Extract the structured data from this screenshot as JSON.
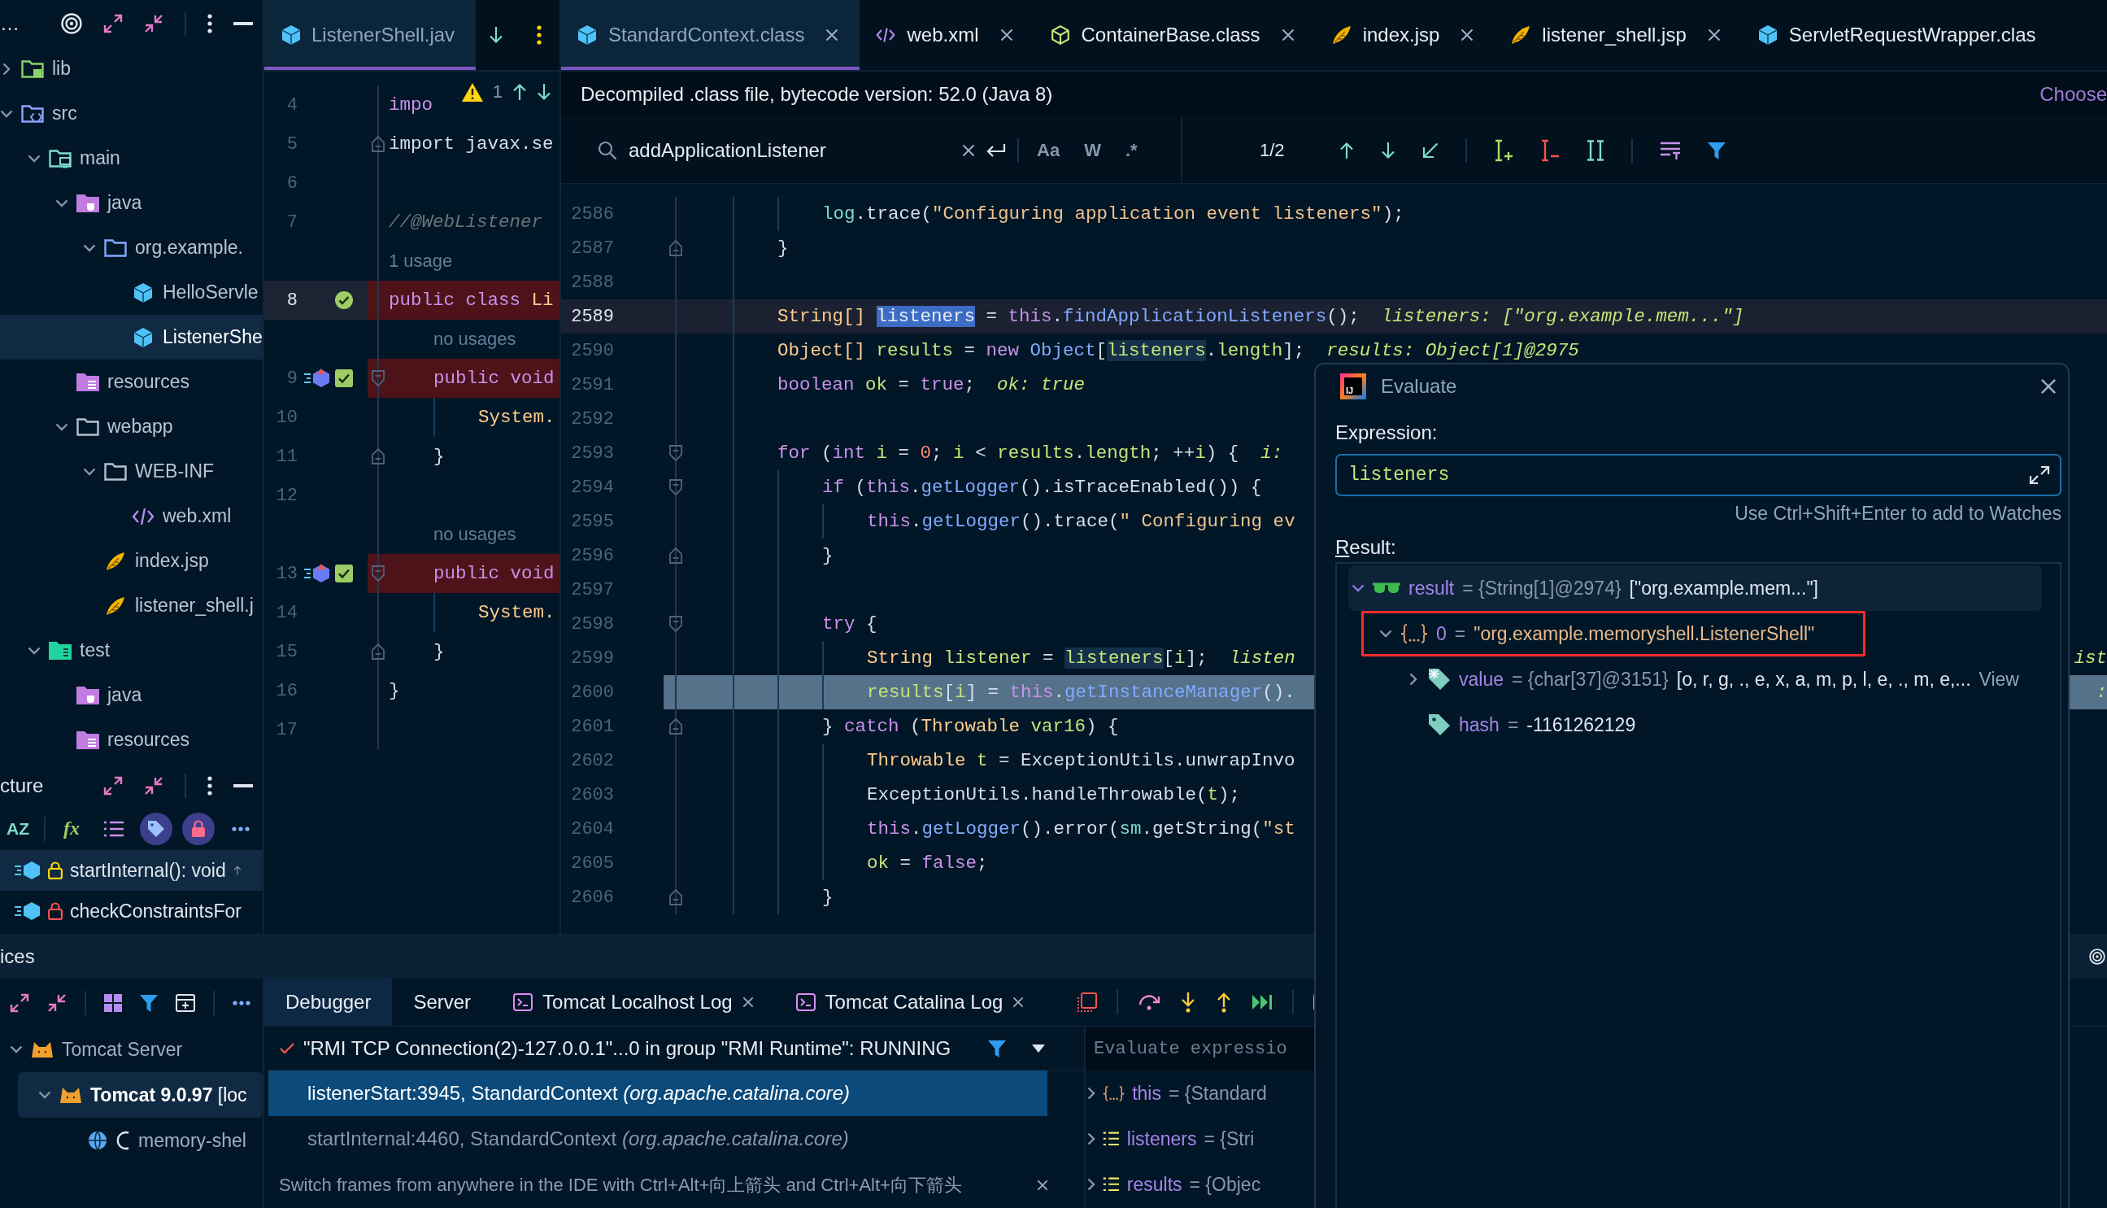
{
  "project_panel": {
    "title": "…",
    "tree": [
      {
        "label": "lib",
        "kind": "library",
        "expandable": true,
        "expanded": false,
        "selected": false
      },
      {
        "label": "src",
        "kind": "source_folder",
        "expandable": true,
        "expanded": true,
        "selected": false,
        "children": [
          {
            "label": "main",
            "kind": "module_folder",
            "expandable": true,
            "expanded": true,
            "selected": false,
            "children": [
              {
                "label": "java",
                "kind": "java_root",
                "expandable": true,
                "expanded": true,
                "selected": false,
                "children": [
                  {
                    "label": "org.example.",
                    "kind": "package",
                    "expandable": true,
                    "expanded": true,
                    "selected": false,
                    "children": [
                      {
                        "label": "HelloServle",
                        "kind": "class",
                        "expandable": false,
                        "selected": false
                      },
                      {
                        "label": "ListenerShe",
                        "kind": "class",
                        "expandable": false,
                        "selected": true
                      }
                    ]
                  }
                ]
              },
              {
                "label": "resources",
                "kind": "resources_root",
                "expandable": false,
                "selected": false
              },
              {
                "label": "webapp",
                "kind": "folder",
                "expandable": true,
                "expanded": true,
                "selected": false,
                "children": [
                  {
                    "label": "WEB-INF",
                    "kind": "folder",
                    "expandable": true,
                    "expanded": true,
                    "selected": false,
                    "children": [
                      {
                        "label": "web.xml",
                        "kind": "xml",
                        "expandable": false,
                        "selected": false
                      }
                    ]
                  },
                  {
                    "label": "index.jsp",
                    "kind": "jsp",
                    "expandable": false,
                    "selected": false
                  },
                  {
                    "label": "listener_shell.j",
                    "kind": "jsp",
                    "expandable": false,
                    "selected": false
                  }
                ]
              }
            ]
          },
          {
            "label": "test",
            "kind": "test_root",
            "expandable": true,
            "expanded": true,
            "selected": false,
            "children": [
              {
                "label": "java",
                "kind": "java_root",
                "expandable": false,
                "selected": false
              },
              {
                "label": "resources",
                "kind": "resources_root",
                "expandable": false,
                "selected": false
              }
            ]
          }
        ]
      }
    ]
  },
  "structure_panel": {
    "title": "cture",
    "toolbar": [
      {
        "kind": "sort",
        "text": "AZ",
        "on": false
      },
      {
        "kind": "functions",
        "text": "fx",
        "on": false
      },
      {
        "kind": "list",
        "on": false
      },
      {
        "kind": "tag",
        "on": true
      },
      {
        "kind": "lock",
        "on": true
      },
      {
        "kind": "more",
        "on": false
      }
    ],
    "items": [
      {
        "label": "startInternal(): void",
        "kind": "protected_method",
        "overrides": true,
        "selected": true
      },
      {
        "label": "checkConstraintsFor",
        "kind": "private_method",
        "overrides": false,
        "selected": false
      }
    ]
  },
  "left_editor": {
    "tabs": [
      {
        "label": "ListenerShell.jav",
        "kind": "class",
        "closable": false,
        "selected": true
      }
    ],
    "inspection": {
      "warnings": "1"
    },
    "lines": [
      {
        "number": "4",
        "caret": false,
        "breakpoint": false,
        "tokens": [
          {
            "kind": "kw",
            "text": "impo"
          }
        ]
      },
      {
        "number": "5",
        "caret": false,
        "breakpoint": false,
        "markers": [
          {
            "kind": "fold_end"
          }
        ],
        "tokens": [
          {
            "kind": "plain",
            "text": "import javax.se"
          }
        ]
      },
      {
        "number": "6",
        "caret": false,
        "breakpoint": false
      },
      {
        "number": "7",
        "caret": false,
        "breakpoint": false,
        "tokens": [
          {
            "kind": "comment",
            "text": "//@WebListener"
          }
        ]
      },
      {
        "number": "8",
        "hint": "1 usage",
        "caret": true,
        "breakpoint": true,
        "markers": [
          {
            "kind": "verified_breakpoint"
          }
        ],
        "tokens": [
          {
            "kind": "kw",
            "text": "public class "
          },
          {
            "kind": "type",
            "text": "Li"
          }
        ],
        "children": [
          {
            "number": "9",
            "hint": "no usages",
            "caret": false,
            "breakpoint": true,
            "markers": [
              {
                "kind": "method_breakpoint"
              },
              {
                "kind": "enabled_checkbox"
              },
              {
                "kind": "fold_start"
              }
            ],
            "tokens": [
              {
                "kind": "kw",
                "text": "public void"
              }
            ],
            "children": [
              {
                "number": "10",
                "caret": false,
                "breakpoint": false,
                "tokens": [
                  {
                    "kind": "type",
                    "text": "System."
                  }
                ]
              }
            ]
          },
          {
            "number": "11",
            "caret": false,
            "breakpoint": false,
            "markers": [
              {
                "kind": "fold_end"
              }
            ],
            "tokens": [
              {
                "kind": "plain",
                "text": "}"
              }
            ]
          },
          {
            "number": "12",
            "caret": false,
            "breakpoint": false
          },
          {
            "number": "13",
            "hint": "no usages",
            "caret": false,
            "breakpoint": true,
            "markers": [
              {
                "kind": "method_breakpoint"
              },
              {
                "kind": "enabled_checkbox"
              },
              {
                "kind": "fold_start"
              }
            ],
            "tokens": [
              {
                "kind": "kw",
                "text": "public void"
              }
            ],
            "children": [
              {
                "number": "14",
                "caret": false,
                "breakpoint": false,
                "tokens": [
                  {
                    "kind": "type",
                    "text": "System."
                  }
                ]
              }
            ]
          },
          {
            "number": "15",
            "caret": false,
            "breakpoint": false,
            "markers": [
              {
                "kind": "fold_end"
              }
            ],
            "tokens": [
              {
                "kind": "plain",
                "text": "}"
              }
            ]
          }
        ]
      },
      {
        "number": "16",
        "caret": false,
        "breakpoint": false,
        "tokens": [
          {
            "kind": "plain",
            "text": "}"
          }
        ]
      },
      {
        "number": "17",
        "caret": false,
        "breakpoint": false
      }
    ]
  },
  "main_editor": {
    "tabs": [
      {
        "label": "StandardContext.class",
        "kind": "class",
        "closable": true,
        "selected": true
      },
      {
        "label": "web.xml",
        "kind": "xml",
        "closable": true,
        "selected": false
      },
      {
        "label": "ContainerBase.class",
        "kind": "abstract_class",
        "closable": true,
        "selected": false
      },
      {
        "label": "index.jsp",
        "kind": "jsp",
        "closable": true,
        "selected": false
      },
      {
        "label": "listener_shell.jsp",
        "kind": "jsp",
        "closable": true,
        "selected": false
      },
      {
        "label": "ServletRequestWrapper.clas",
        "kind": "class",
        "closable": false,
        "selected": false
      }
    ],
    "info_bar": {
      "text": "Decompiled .class file, bytecode version: 52.0 (Java 8)",
      "action": "Choose"
    },
    "search": {
      "value": "addApplicationListener",
      "options": [
        {
          "text": "Aa",
          "on": false
        },
        {
          "text": "W",
          "on": false
        },
        {
          "text": ".*",
          "on": false
        }
      ],
      "match_count": "1/2"
    },
    "continued_lines": [
      {
        "number": "2586",
        "caret": false,
        "execution": false,
        "tokens": [
          {
            "kind": "field",
            "text": "log"
          },
          {
            "kind": "plain",
            "text": ".trace("
          },
          {
            "kind": "str",
            "text": "\"Configuring application event listeners\""
          },
          {
            "kind": "plain",
            "text": ");"
          }
        ]
      }
    ],
    "lines": [
      {
        "number": "2587",
        "caret": false,
        "execution": false,
        "markers": [
          {
            "kind": "fold_end"
          }
        ],
        "tokens": [
          {
            "kind": "plain",
            "text": "}"
          }
        ]
      },
      {
        "number": "2588",
        "caret": false,
        "execution": false
      },
      {
        "number": "2589",
        "caret": true,
        "execution": false,
        "tokens": [
          {
            "kind": "type",
            "text": "String[] "
          },
          {
            "kind": "sel",
            "text": "listeners"
          },
          {
            "kind": "plain",
            "text": " = "
          },
          {
            "kind": "kw",
            "text": "this"
          },
          {
            "kind": "plain",
            "text": "."
          },
          {
            "kind": "fn",
            "text": "findApplicationListeners"
          },
          {
            "kind": "plain",
            "text": "();"
          }
        ],
        "inline": "listeners: [\"org.example.mem...\"]"
      },
      {
        "number": "2590",
        "caret": false,
        "execution": false,
        "tokens": [
          {
            "kind": "type",
            "text": "Object[] "
          },
          {
            "kind": "var",
            "text": "results"
          },
          {
            "kind": "plain",
            "text": " = "
          },
          {
            "kind": "kw",
            "text": "new "
          },
          {
            "kind": "cls",
            "text": "Object"
          },
          {
            "kind": "plain",
            "text": "["
          },
          {
            "kind": "usage",
            "text": "listeners"
          },
          {
            "kind": "plain",
            "text": "."
          },
          {
            "kind": "var",
            "text": "length"
          },
          {
            "kind": "plain",
            "text": "];"
          }
        ],
        "inline": "results: Object[1]@2975"
      },
      {
        "number": "2591",
        "caret": false,
        "execution": false,
        "tokens": [
          {
            "kind": "kw",
            "text": "boolean "
          },
          {
            "kind": "var",
            "text": "ok"
          },
          {
            "kind": "plain",
            "text": " = "
          },
          {
            "kind": "kw",
            "text": "true"
          },
          {
            "kind": "plain",
            "text": ";"
          }
        ],
        "inline": "ok: true"
      },
      {
        "number": "2592",
        "caret": false,
        "execution": false
      },
      {
        "number": "2593",
        "caret": false,
        "execution": false,
        "markers": [
          {
            "kind": "fold_start"
          }
        ],
        "tokens": [
          {
            "kind": "kw",
            "text": "for"
          },
          {
            "kind": "plain",
            "text": " ("
          },
          {
            "kind": "kw",
            "text": "int "
          },
          {
            "kind": "var",
            "text": "i"
          },
          {
            "kind": "plain",
            "text": " = "
          },
          {
            "kind": "num",
            "text": "0"
          },
          {
            "kind": "plain",
            "text": "; "
          },
          {
            "kind": "var",
            "text": "i"
          },
          {
            "kind": "plain",
            "text": " < "
          },
          {
            "kind": "var",
            "text": "results"
          },
          {
            "kind": "plain",
            "text": "."
          },
          {
            "kind": "var",
            "text": "length"
          },
          {
            "kind": "plain",
            "text": "; ++"
          },
          {
            "kind": "var",
            "text": "i"
          },
          {
            "kind": "plain",
            "text": ") {"
          }
        ],
        "inline": "i:",
        "children": [
          {
            "number": "2594",
            "caret": false,
            "execution": false,
            "markers": [
              {
                "kind": "fold_start"
              }
            ],
            "tokens": [
              {
                "kind": "kw",
                "text": "if"
              },
              {
                "kind": "plain",
                "text": " ("
              },
              {
                "kind": "kw",
                "text": "this"
              },
              {
                "kind": "plain",
                "text": "."
              },
              {
                "kind": "fn",
                "text": "getLogger"
              },
              {
                "kind": "plain",
                "text": "().isTraceEnabled()) {"
              }
            ],
            "children": [
              {
                "number": "2595",
                "caret": false,
                "execution": false,
                "tokens": [
                  {
                    "kind": "kw",
                    "text": "this"
                  },
                  {
                    "kind": "plain",
                    "text": "."
                  },
                  {
                    "kind": "fn",
                    "text": "getLogger"
                  },
                  {
                    "kind": "plain",
                    "text": "().trace("
                  },
                  {
                    "kind": "str",
                    "text": "\" Configuring ev"
                  }
                ]
              }
            ]
          },
          {
            "number": "2596",
            "caret": false,
            "execution": false,
            "markers": [
              {
                "kind": "fold_end"
              }
            ],
            "tokens": [
              {
                "kind": "plain",
                "text": "}"
              }
            ]
          },
          {
            "number": "2597",
            "caret": false,
            "execution": false
          },
          {
            "number": "2598",
            "caret": false,
            "execution": false,
            "markers": [
              {
                "kind": "fold_start"
              }
            ],
            "tokens": [
              {
                "kind": "kw",
                "text": "try"
              },
              {
                "kind": "plain",
                "text": " {"
              }
            ],
            "children": [
              {
                "number": "2599",
                "caret": false,
                "execution": false,
                "tokens": [
                  {
                    "kind": "type",
                    "text": "String "
                  },
                  {
                    "kind": "var",
                    "text": "listener"
                  },
                  {
                    "kind": "plain",
                    "text": " = "
                  },
                  {
                    "kind": "usage",
                    "text": "listeners"
                  },
                  {
                    "kind": "plain",
                    "text": "["
                  },
                  {
                    "kind": "var",
                    "text": "i"
                  },
                  {
                    "kind": "plain",
                    "text": "];"
                  }
                ],
                "inline": "listen",
                "right": "ist"
              },
              {
                "number": "2600",
                "caret": false,
                "execution": true,
                "tokens": [
                  {
                    "kind": "var",
                    "text": "results"
                  },
                  {
                    "kind": "plain",
                    "text": "["
                  },
                  {
                    "kind": "var",
                    "text": "i"
                  },
                  {
                    "kind": "plain",
                    "text": "] = "
                  },
                  {
                    "kind": "kw",
                    "text": "this"
                  },
                  {
                    "kind": "plain",
                    "text": "."
                  },
                  {
                    "kind": "fn",
                    "text": "getInstanceManager"
                  },
                  {
                    "kind": "plain",
                    "text": "()."
                  }
                ],
                "right": ":"
              }
            ]
          },
          {
            "number": "2601",
            "caret": false,
            "execution": false,
            "markers": [
              {
                "kind": "fold_end"
              }
            ],
            "tokens": [
              {
                "kind": "plain",
                "text": "} "
              },
              {
                "kind": "kw",
                "text": "catch"
              },
              {
                "kind": "plain",
                "text": " ("
              },
              {
                "kind": "type",
                "text": "Throwable "
              },
              {
                "kind": "var",
                "text": "var16"
              },
              {
                "kind": "plain",
                "text": ") {"
              }
            ],
            "children": [
              {
                "number": "2602",
                "caret": false,
                "execution": false,
                "tokens": [
                  {
                    "kind": "type",
                    "text": "Throwable "
                  },
                  {
                    "kind": "var",
                    "text": "t"
                  },
                  {
                    "kind": "plain",
                    "text": " = ExceptionUtils.unwrapInvo"
                  }
                ]
              },
              {
                "number": "2603",
                "caret": false,
                "execution": false,
                "tokens": [
                  {
                    "kind": "plain",
                    "text": "ExceptionUtils.handleThrowable("
                  },
                  {
                    "kind": "var",
                    "text": "t"
                  },
                  {
                    "kind": "plain",
                    "text": ");"
                  }
                ]
              },
              {
                "number": "2604",
                "caret": false,
                "execution": false,
                "tokens": [
                  {
                    "kind": "kw",
                    "text": "this"
                  },
                  {
                    "kind": "plain",
                    "text": "."
                  },
                  {
                    "kind": "fn",
                    "text": "getLogger"
                  },
                  {
                    "kind": "plain",
                    "text": "().error("
                  },
                  {
                    "kind": "field",
                    "text": "sm"
                  },
                  {
                    "kind": "plain",
                    "text": ".getString("
                  },
                  {
                    "kind": "str",
                    "text": "\"st"
                  }
                ]
              },
              {
                "number": "2605",
                "caret": false,
                "execution": false,
                "tokens": [
                  {
                    "kind": "var",
                    "text": "ok"
                  },
                  {
                    "kind": "plain",
                    "text": " = "
                  },
                  {
                    "kind": "kw",
                    "text": "false"
                  },
                  {
                    "kind": "plain",
                    "text": ";"
                  }
                ]
              }
            ]
          },
          {
            "number": "2606",
            "caret": false,
            "execution": false,
            "markers": [
              {
                "kind": "fold_end"
              }
            ],
            "tokens": [
              {
                "kind": "plain",
                "text": "}"
              }
            ]
          }
        ]
      }
    ]
  },
  "services": {
    "title": "ices",
    "toolbar_tabs": [
      {
        "label": "Debugger",
        "kind": "plain",
        "closable": false,
        "selected": true
      },
      {
        "label": "Server",
        "kind": "plain",
        "closable": false,
        "selected": false
      },
      {
        "label": "Tomcat Localhost Log",
        "kind": "log",
        "closable": true,
        "selected": false
      },
      {
        "label": "Tomcat Catalina Log",
        "kind": "log",
        "closable": true,
        "selected": false
      }
    ],
    "tree": [
      {
        "label": "Tomcat Server",
        "kind": "server",
        "expandable": true,
        "expanded": true,
        "selected": false,
        "busy": false,
        "children": [
          {
            "label": "**Tomcat 9.0.97** [loc",
            "kind": "server",
            "expandable": true,
            "expanded": true,
            "selected": true,
            "busy": false,
            "children": [
              {
                "label": "memory-shel",
                "kind": "artifact",
                "expandable": false,
                "selected": false,
                "busy": true
              }
            ]
          }
        ]
      }
    ],
    "thread": {
      "text": "\"RMI TCP Connection(2)-127.0.0.1\"...0 in group \"RMI Runtime\": RUNNING"
    },
    "frames": [
      {
        "text": "listenerStart:3945, StandardContext *(org.apache.catalina.core)*",
        "selected": true
      },
      {
        "text": "startInternal:4460, StandardContext *(org.apache.catalina.core)*",
        "selected": false
      }
    ],
    "tip": "Switch frames from anywhere in the IDE with Ctrl+Alt+向上箭头 and Ctrl+Alt+向下箭头",
    "variables": {
      "placeholder": "Evaluate expressio",
      "items": [
        {
          "name": "this",
          "detail": "= {Standard",
          "kind": "object",
          "expandable": true,
          "expanded": false
        },
        {
          "name": "listeners",
          "detail": "= {Stri",
          "kind": "array",
          "expandable": true,
          "expanded": false
        },
        {
          "name": "results",
          "detail": "= {Objec",
          "kind": "array",
          "expandable": true,
          "expanded": false
        }
      ]
    }
  },
  "evaluate": {
    "logo": "IJ",
    "title": "Evaluate",
    "expression_label": "Expression:",
    "expression": "listeners",
    "hint": "Use Ctrl+Shift+Enter to add to Watches",
    "result_label": "Result:",
    "result": [
      {
        "name": "result",
        "detail": "= {String[1]@2974}",
        "value": "[\"org.example.mem...\"]",
        "string": false,
        "kind": "result",
        "expandable": true,
        "expanded": true,
        "selected": true,
        "annotated": false,
        "children": [
          {
            "name": "0",
            "detail": "=",
            "value": "\"org.example.memoryshell.ListenerShell\"",
            "string": true,
            "kind": "object",
            "expandable": true,
            "expanded": true,
            "selected": false,
            "annotated": true,
            "children": [
              {
                "name": "value",
                "detail": "= {char[37]@3151}",
                "value": "[o, r, g, ., e, x, a, m, p, l, e, ., m, e,...",
                "link": "View",
                "string": false,
                "kind": "final_field",
                "expandable": true,
                "expanded": false,
                "selected": false,
                "annotated": false
              },
              {
                "name": "hash",
                "detail": "=",
                "value": "-1161262129",
                "string": false,
                "kind": "field",
                "expandable": false,
                "selected": false,
                "annotated": false
              }
            ]
          }
        ]
      }
    ]
  }
}
